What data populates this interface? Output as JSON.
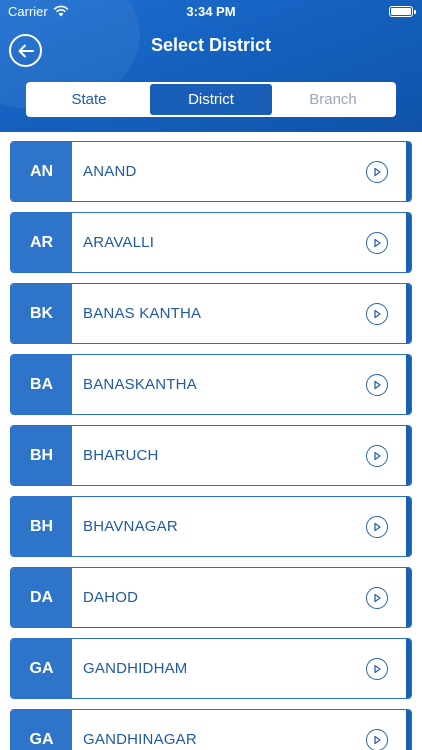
{
  "status_bar": {
    "carrier": "Carrier",
    "time": "3:34 PM"
  },
  "nav": {
    "title": "Select District"
  },
  "tabs": [
    {
      "label": "State",
      "state": "normal"
    },
    {
      "label": "District",
      "state": "active"
    },
    {
      "label": "Branch",
      "state": "disabled"
    }
  ],
  "districts": [
    {
      "code": "AN",
      "name": "ANAND"
    },
    {
      "code": "AR",
      "name": "ARAVALLI"
    },
    {
      "code": "BK",
      "name": "BANAS KANTHA"
    },
    {
      "code": "BA",
      "name": "BANASKANTHA"
    },
    {
      "code": "BH",
      "name": "BHARUCH"
    },
    {
      "code": "BH",
      "name": "BHAVNAGAR"
    },
    {
      "code": "DA",
      "name": "DAHOD"
    },
    {
      "code": "GA",
      "name": "GANDHIDHAM"
    },
    {
      "code": "GA",
      "name": "GANDHINAGAR"
    }
  ],
  "colors": {
    "primary": "#1a5fb7",
    "badge": "#2e74c8",
    "text": "#1f5aa3"
  }
}
